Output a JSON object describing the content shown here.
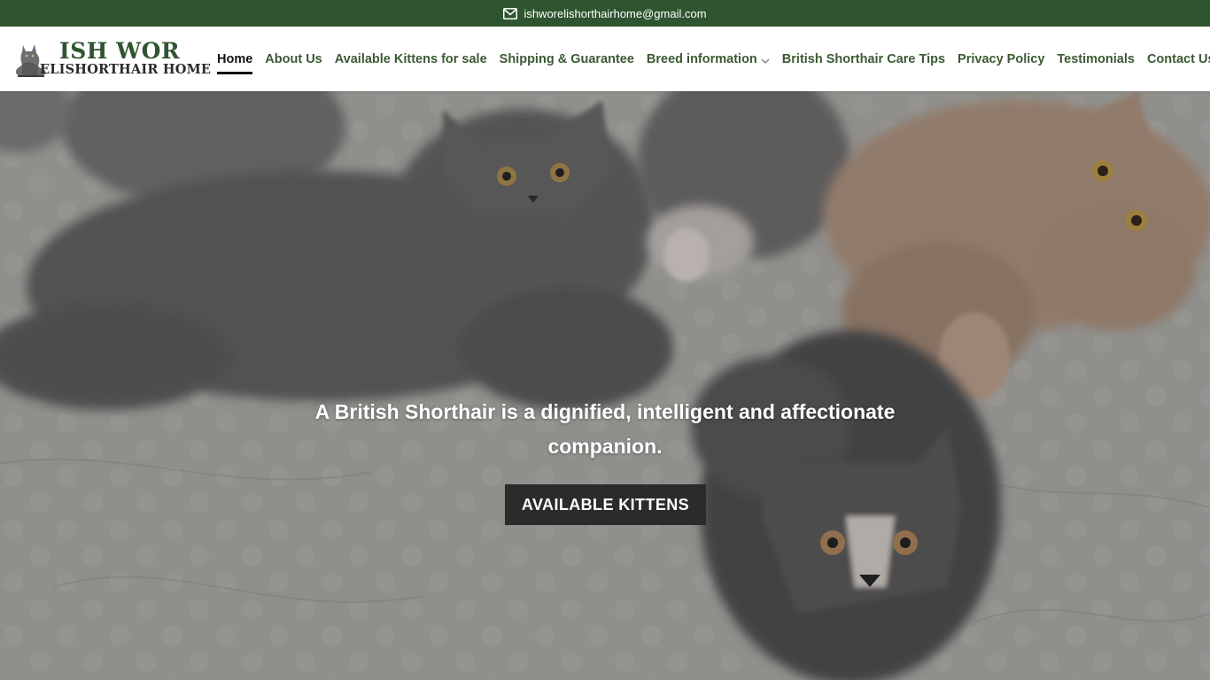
{
  "topbar": {
    "email": "ishworelishorthairhome@gmail.com",
    "email_icon": "envelope-icon",
    "background": "#2f5530"
  },
  "logo": {
    "line1": "ISH WOR",
    "line2": "ELISHORTHAIR HOME",
    "icon": "cat-silhouette-icon"
  },
  "nav": {
    "items": [
      {
        "label": "Home",
        "active": true
      },
      {
        "label": "About Us"
      },
      {
        "label": "Available Kittens for sale"
      },
      {
        "label": "Shipping & Guarantee"
      },
      {
        "label": "Breed information",
        "has_dropdown": true,
        "dropdown_icon": "chevron-down-icon"
      },
      {
        "label": "British Shorthair Care Tips"
      },
      {
        "label": "Privacy Policy"
      },
      {
        "label": "Testimonials"
      },
      {
        "label": "Contact Us"
      }
    ],
    "color": "#3b5a33"
  },
  "hero": {
    "headline": "A British Shorthair is a dignified, intelligent and affectionate companion.",
    "button_label": "AVAILABLE KITTENS",
    "button_color": "#2b2b2b"
  }
}
